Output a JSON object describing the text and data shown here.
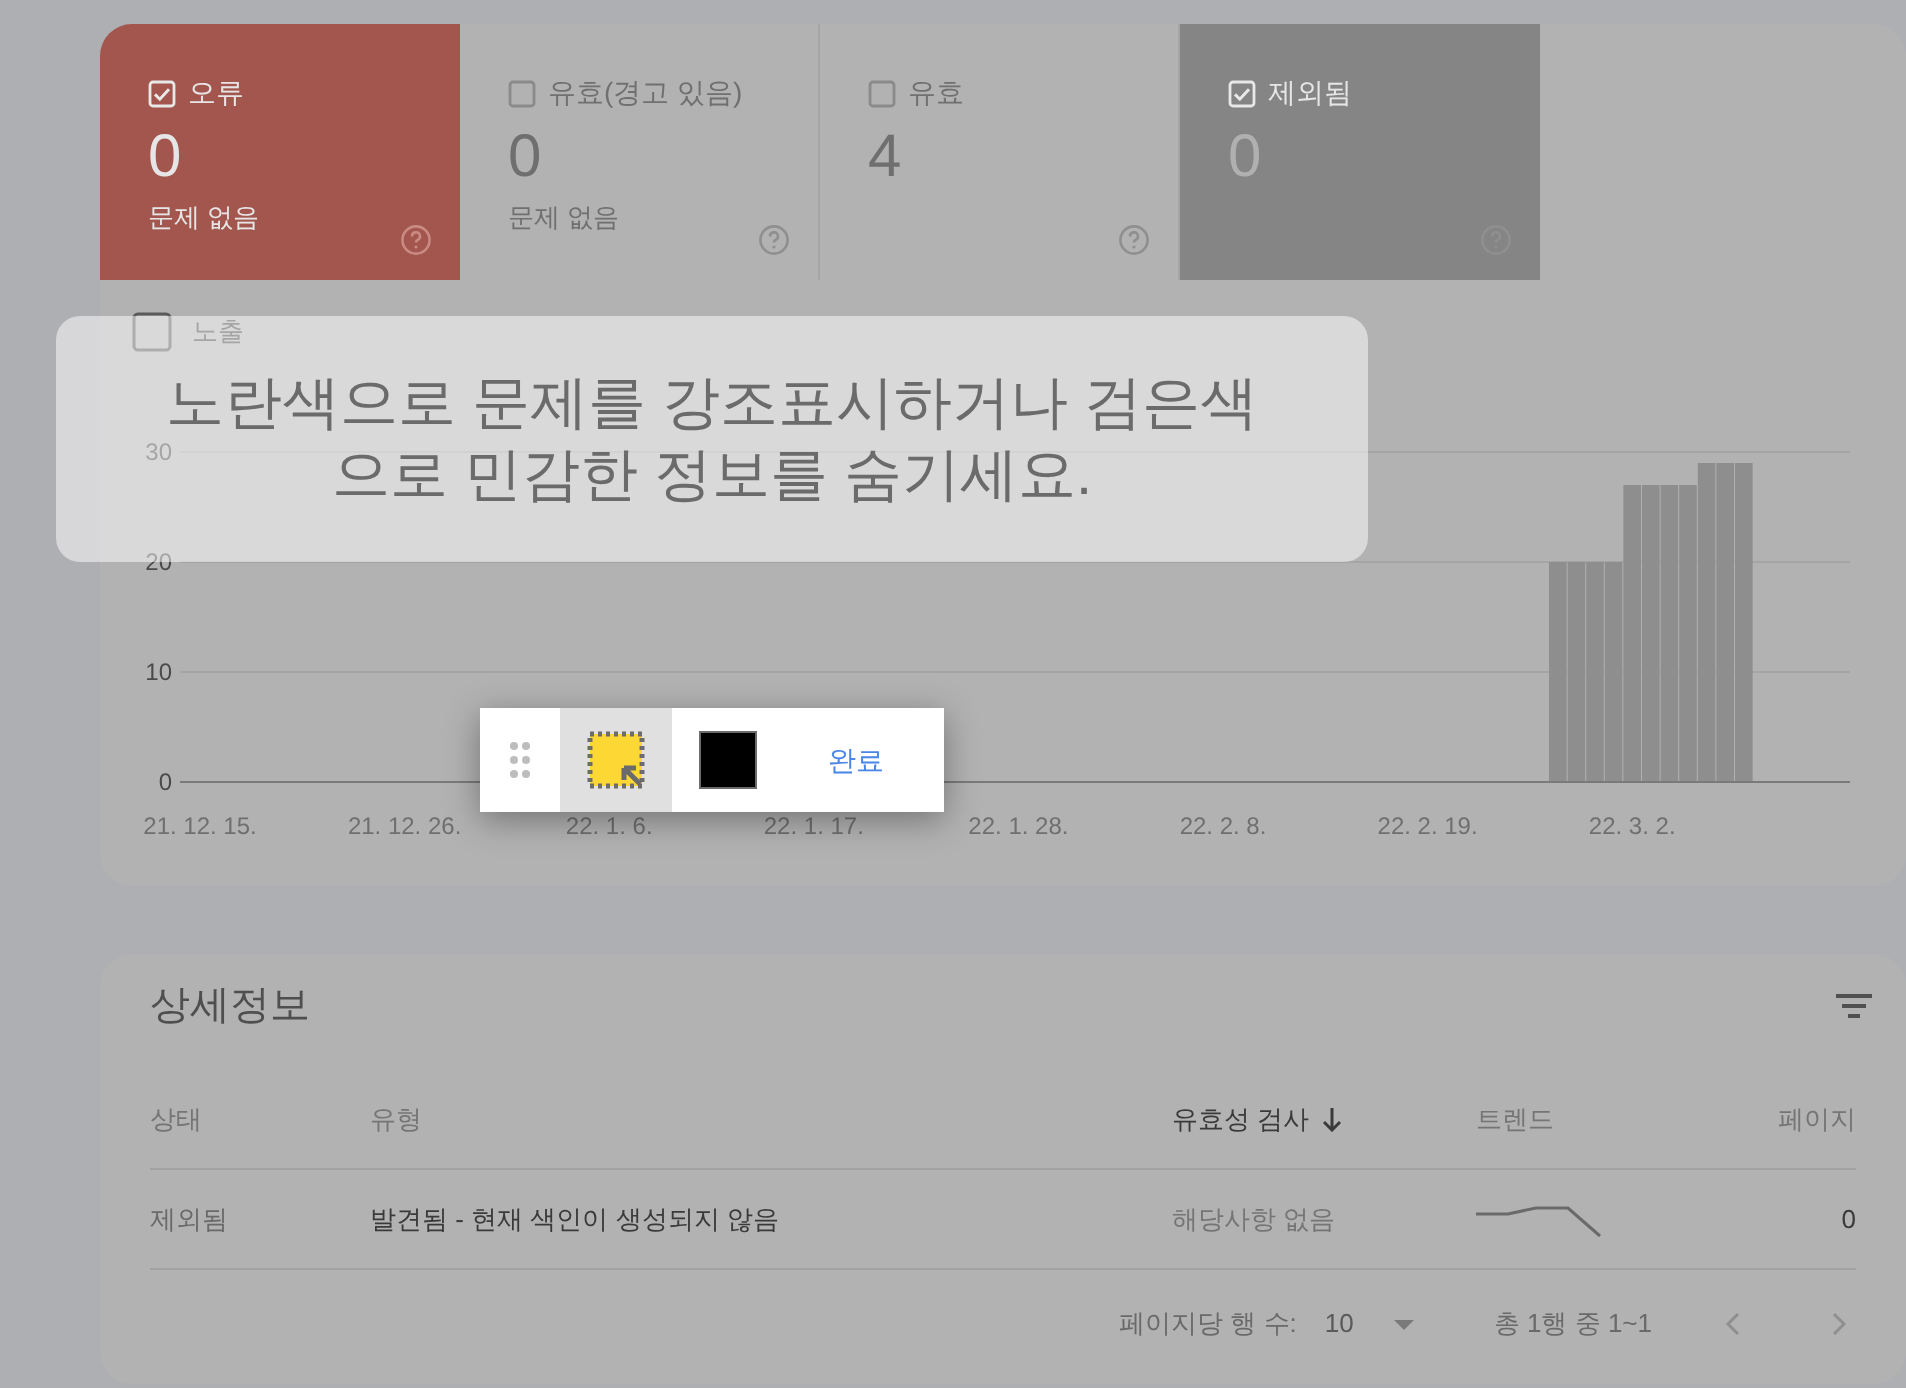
{
  "tiles": [
    {
      "label": "오류",
      "checked": true,
      "count": "0",
      "subtitle": "문제 없음",
      "color": "#a3564d"
    },
    {
      "label": "유효(경고 있음)",
      "checked": false,
      "count": "0",
      "subtitle": "문제 없음",
      "color": "#b2b2b2"
    },
    {
      "label": "유효",
      "checked": false,
      "count": "4",
      "color": "#b2b2b2"
    },
    {
      "label": "제외됨",
      "checked": true,
      "count": "0",
      "color": "#858585"
    }
  ],
  "chart": {
    "toggle": {
      "label": "노출",
      "checked": false
    },
    "chart_data": {
      "type": "bar",
      "ylim": [
        0,
        30
      ],
      "yticks": [
        0,
        10,
        20,
        30
      ],
      "grid": true,
      "categories": [
        "21. 12. 15.",
        null,
        null,
        null,
        null,
        null,
        null,
        null,
        null,
        null,
        null,
        "21. 12. 26.",
        null,
        null,
        null,
        null,
        null,
        null,
        null,
        null,
        null,
        null,
        "22. 1. 6.",
        null,
        null,
        null,
        null,
        null,
        null,
        null,
        null,
        null,
        null,
        "22. 1. 17.",
        null,
        null,
        null,
        null,
        null,
        null,
        null,
        null,
        null,
        null,
        "22. 1. 28.",
        null,
        null,
        null,
        null,
        null,
        null,
        null,
        null,
        null,
        null,
        "22. 2. 8.",
        null,
        null,
        null,
        null,
        null,
        null,
        null,
        null,
        null,
        null,
        "22. 2. 19.",
        null,
        null,
        null,
        null,
        null,
        null,
        null,
        null,
        null,
        null,
        "22. 3. 2.",
        null,
        null,
        null,
        null,
        null,
        null
      ],
      "values": [
        null,
        null,
        null,
        null,
        null,
        null,
        null,
        null,
        null,
        null,
        null,
        null,
        null,
        null,
        null,
        null,
        null,
        null,
        null,
        null,
        null,
        null,
        null,
        null,
        null,
        null,
        null,
        null,
        null,
        null,
        null,
        null,
        null,
        null,
        null,
        null,
        null,
        null,
        null,
        null,
        null,
        null,
        null,
        null,
        null,
        null,
        null,
        null,
        null,
        null,
        null,
        null,
        null,
        null,
        null,
        null,
        null,
        null,
        null,
        null,
        null,
        null,
        null,
        null,
        null,
        null,
        null,
        null,
        null,
        null,
        null,
        null,
        null,
        20,
        20,
        20,
        20,
        27,
        27,
        27,
        27,
        29,
        29,
        29
      ]
    }
  },
  "details": {
    "title": "상세정보",
    "columns": [
      {
        "label": "상태",
        "sorted": false
      },
      {
        "label": "유형",
        "sorted": false
      },
      {
        "label": "유효성 검사",
        "sorted": true
      },
      {
        "label": "트렌드",
        "sorted": false
      },
      {
        "label": "페이지",
        "sorted": false
      }
    ],
    "rows": [
      {
        "status": "제외됨",
        "type": "발견됨 - 현재 색인이 생성되지 않음",
        "validation": "해당사항 없음",
        "pages": "0"
      }
    ],
    "footer": {
      "rows_per_page_label": "페이지당 행 수:",
      "rows_per_page": "10",
      "range": "총 1행 중 1~1"
    }
  },
  "banner": {
    "text": "노란색으로 문제를 강조표시하거나 검은색\n으로 민감한 정보를 숨기세요."
  },
  "toolbar": {
    "tools": [
      {
        "kind": "highlight",
        "selected": true
      },
      {
        "kind": "hide",
        "selected": false
      }
    ],
    "done": "완료"
  }
}
